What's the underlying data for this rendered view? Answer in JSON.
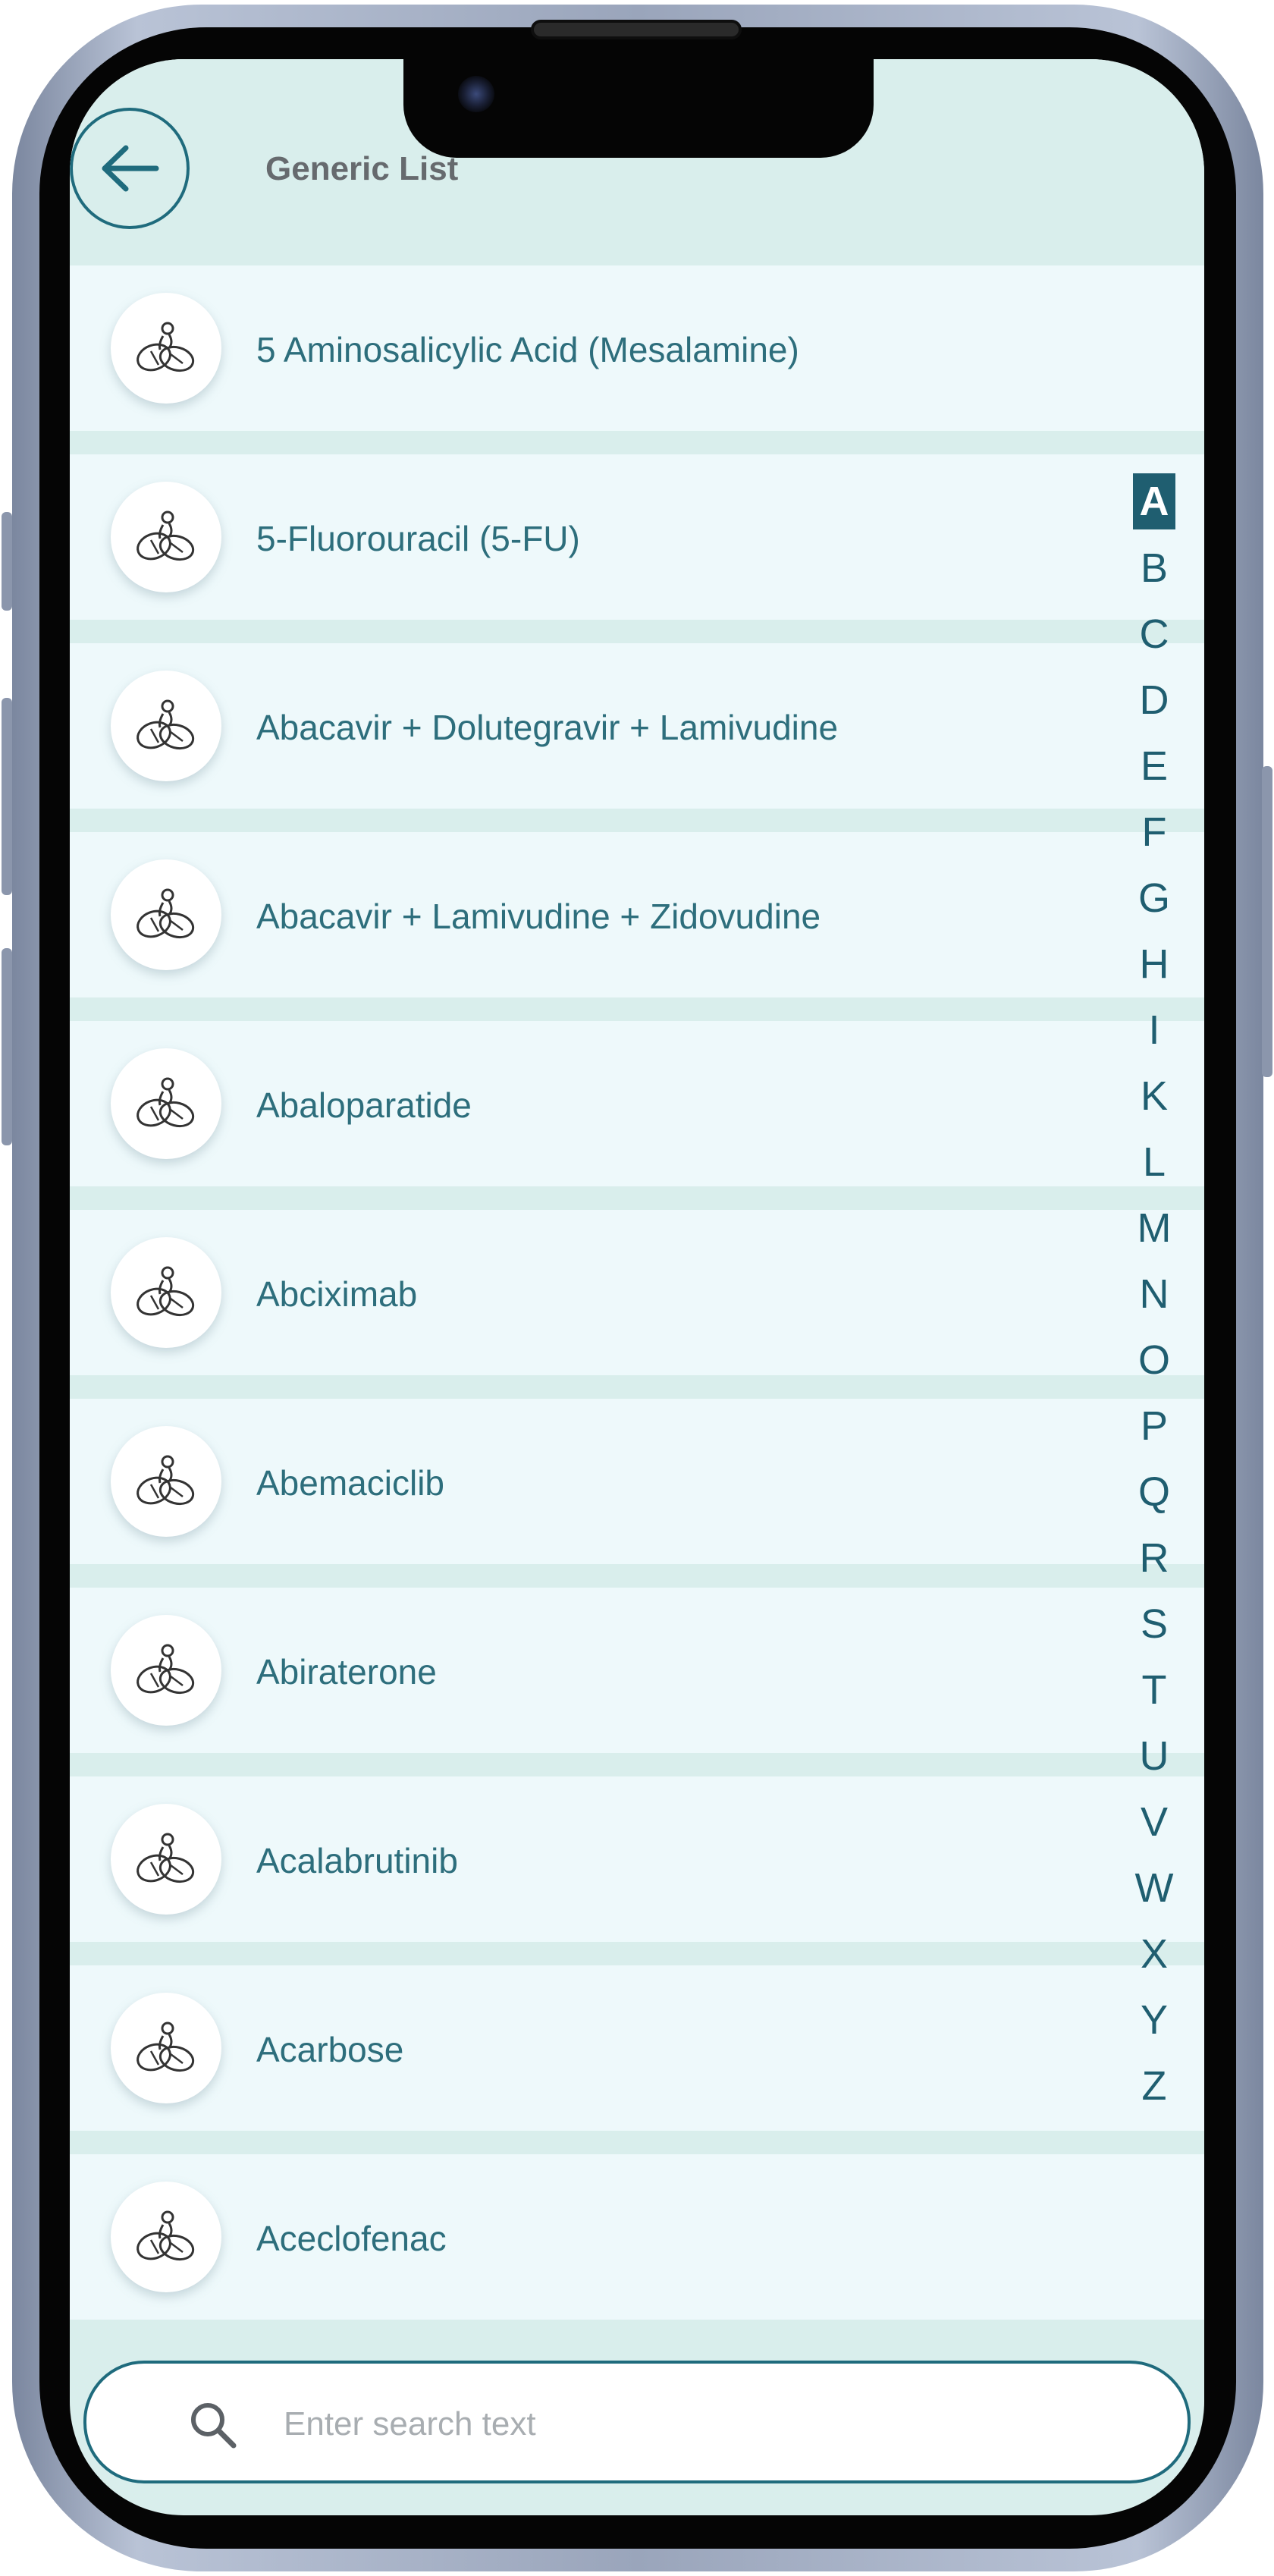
{
  "header": {
    "title": "Generic List",
    "back_icon": "arrow-left-icon"
  },
  "list": {
    "item_icon": "medicine-pills-icon",
    "items": [
      {
        "label": "5 Aminosalicylic Acid (Mesalamine)"
      },
      {
        "label": "5-Fluorouracil (5-FU)"
      },
      {
        "label": "Abacavir + Dolutegravir + Lamivudine"
      },
      {
        "label": "Abacavir + Lamivudine + Zidovudine"
      },
      {
        "label": "Abaloparatide"
      },
      {
        "label": "Abciximab"
      },
      {
        "label": "Abemaciclib"
      },
      {
        "label": "Abiraterone"
      },
      {
        "label": "Acalabrutinib"
      },
      {
        "label": "Acarbose"
      },
      {
        "label": "Aceclofenac"
      }
    ]
  },
  "alphabet_index": {
    "active": "A",
    "letters": [
      "A",
      "B",
      "C",
      "D",
      "E",
      "F",
      "G",
      "H",
      "I",
      "K",
      "L",
      "M",
      "N",
      "O",
      "P",
      "Q",
      "R",
      "S",
      "T",
      "U",
      "V",
      "W",
      "X",
      "Y",
      "Z"
    ]
  },
  "search": {
    "placeholder": "Enter search text",
    "value": "",
    "icon": "search-icon"
  },
  "colors": {
    "accent": "#1f6b7d",
    "background": "#d9eeec",
    "row": "#eef9fb",
    "text": "#2d6e7c"
  }
}
